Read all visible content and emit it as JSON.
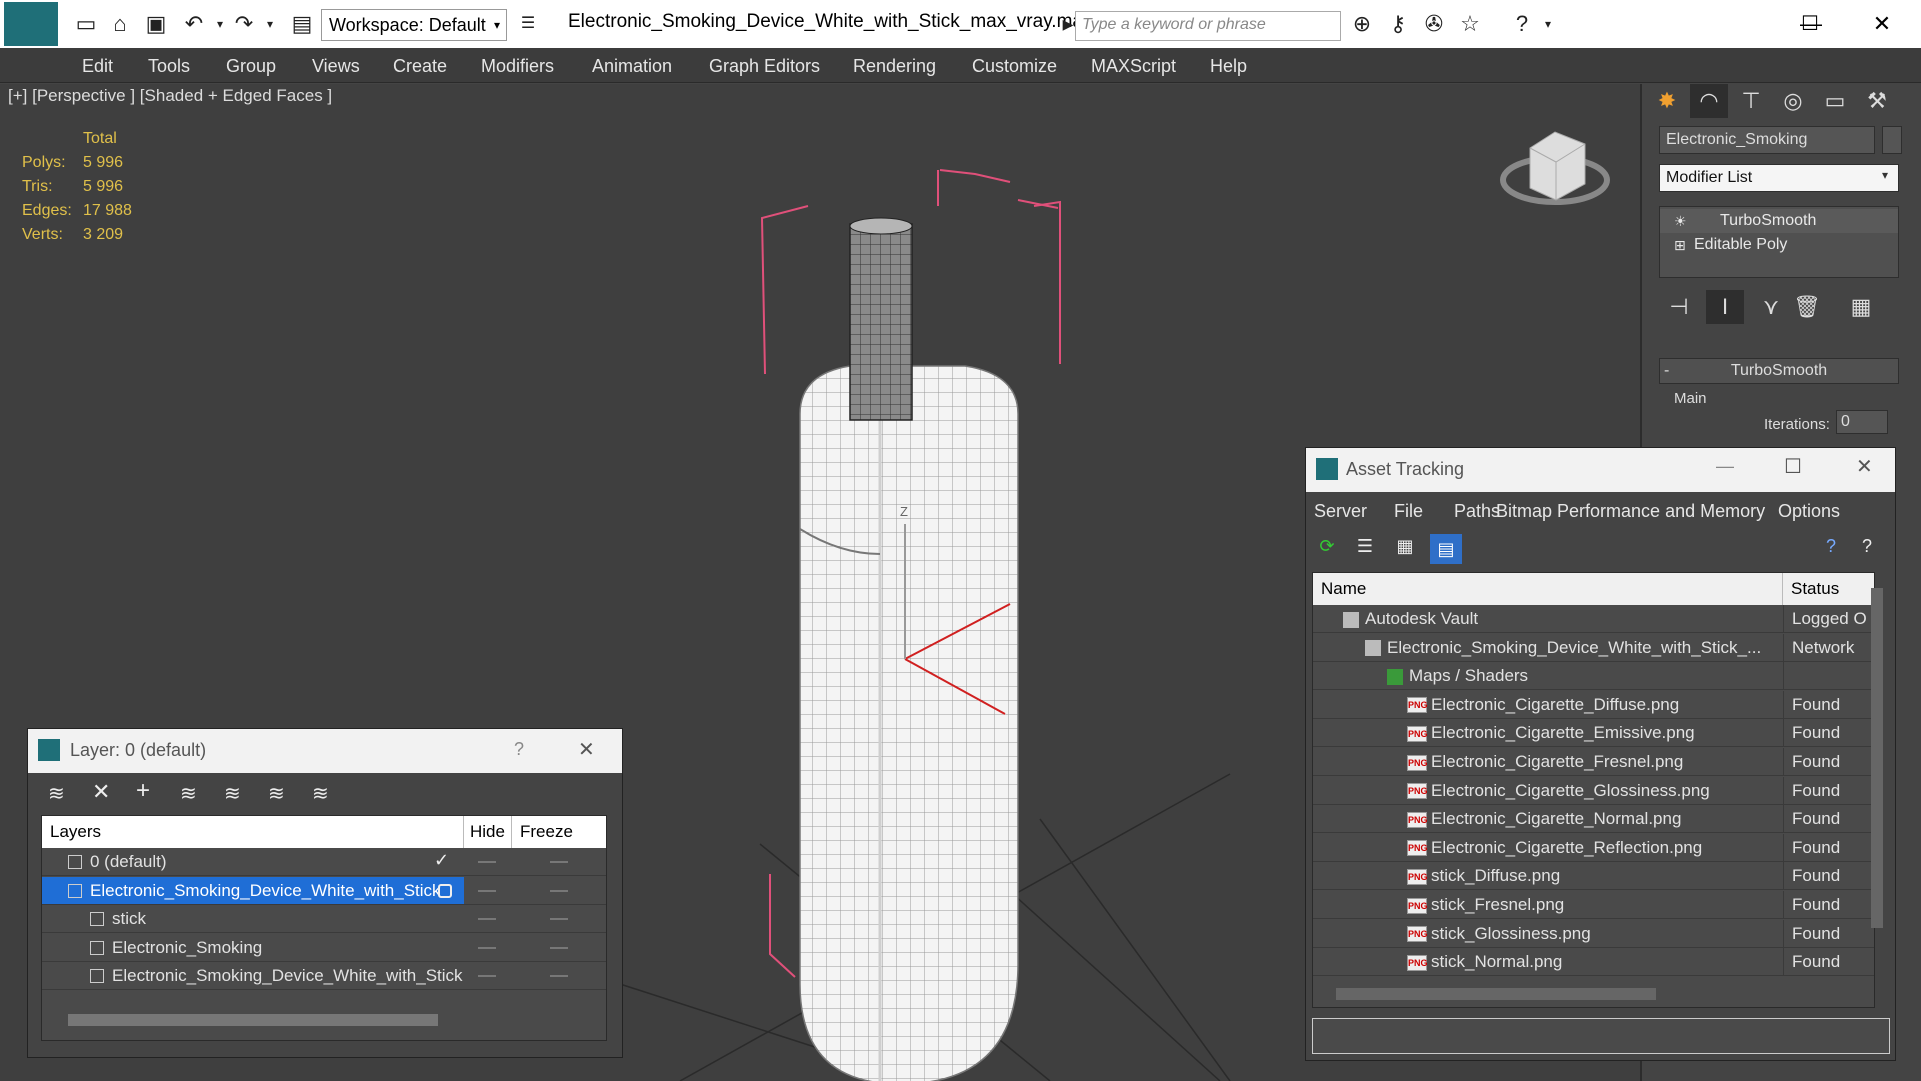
{
  "toolbar": {
    "workspace_label": "Workspace: Default",
    "document_title": "Electronic_Smoking_Device_White_with_Stick_max_vray.max",
    "search_placeholder": "Type a keyword or phrase"
  },
  "menu": [
    "Edit",
    "Tools",
    "Group",
    "Views",
    "Create",
    "Modifiers",
    "Animation",
    "Graph Editors",
    "Rendering",
    "Customize",
    "MAXScript",
    "Help"
  ],
  "viewport": {
    "label": "[+] [Perspective ] [Shaded + Edged Faces ]",
    "stats_header": "Total",
    "stats": [
      {
        "label": "Polys:",
        "value": "5 996"
      },
      {
        "label": "Tris:",
        "value": "5 996"
      },
      {
        "label": "Edges:",
        "value": "17 988"
      },
      {
        "label": "Verts:",
        "value": "3 209"
      }
    ],
    "axis_label": "Z"
  },
  "command_panel": {
    "object_name": "Electronic_Smoking",
    "modifier_list": "Modifier List",
    "stack": [
      "TurboSmooth",
      "Editable Poly"
    ],
    "rollout_title": "TurboSmooth",
    "group_main": "Main",
    "iterations_label": "Iterations:",
    "iterations_value": "0"
  },
  "asset_tracking": {
    "title": "Asset Tracking",
    "menu": [
      "Server",
      "File",
      "Paths",
      "Bitmap Performance and Memory",
      "Options"
    ],
    "columns": {
      "name": "Name",
      "status": "Status"
    },
    "rows": [
      {
        "name": "Autodesk Vault",
        "status": "Logged O"
      },
      {
        "name": "Electronic_Smoking_Device_White_with_Stick_...",
        "status": "Network"
      },
      {
        "name": "Maps / Shaders",
        "status": ""
      },
      {
        "name": "Electronic_Cigarette_Diffuse.png",
        "status": "Found"
      },
      {
        "name": "Electronic_Cigarette_Emissive.png",
        "status": "Found"
      },
      {
        "name": "Electronic_Cigarette_Fresnel.png",
        "status": "Found"
      },
      {
        "name": "Electronic_Cigarette_Glossiness.png",
        "status": "Found"
      },
      {
        "name": "Electronic_Cigarette_Normal.png",
        "status": "Found"
      },
      {
        "name": "Electronic_Cigarette_Reflection.png",
        "status": "Found"
      },
      {
        "name": "stick_Diffuse.png",
        "status": "Found"
      },
      {
        "name": "stick_Fresnel.png",
        "status": "Found"
      },
      {
        "name": "stick_Glossiness.png",
        "status": "Found"
      },
      {
        "name": "stick_Normal.png",
        "status": "Found"
      }
    ],
    "png_badge": "PNG"
  },
  "layer_dialog": {
    "title": "Layer: 0 (default)",
    "help": "?",
    "columns": {
      "layers": "Layers",
      "hide": "Hide",
      "freeze": "Freeze"
    },
    "rows": [
      {
        "name": "0 (default)"
      },
      {
        "name": "Electronic_Smoking_Device_White_with_Stick"
      },
      {
        "name": "stick"
      },
      {
        "name": "Electronic_Smoking"
      },
      {
        "name": "Electronic_Smoking_Device_White_with_Stick"
      }
    ]
  },
  "colors": {
    "accent": "#1e78d8",
    "stat_text": "#e0c04a",
    "selection": "#1f6ed6"
  }
}
